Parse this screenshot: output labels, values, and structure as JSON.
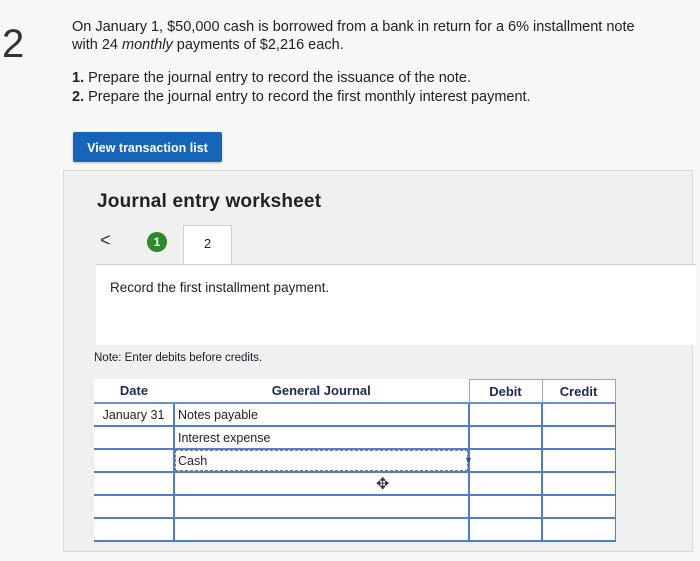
{
  "question_number": "2",
  "prompt": {
    "line1_before": "On January 1, $50,000 cash is borrowed from a bank in return for a 6% installment note",
    "line2_before": "with 24 ",
    "line2_italic": "monthly",
    "line2_after": " payments of $2,216 each."
  },
  "tasks": [
    {
      "num": "1.",
      "text": " Prepare the journal entry to record the issuance of the note."
    },
    {
      "num": "2.",
      "text": " Prepare the journal entry to record the first monthly interest payment."
    }
  ],
  "view_button_label": "View transaction list",
  "worksheet": {
    "title": "Journal entry worksheet",
    "back_symbol": "<",
    "steps": [
      "1",
      "2"
    ],
    "instruction": "Record the first installment payment.",
    "note": "Note: Enter debits before credits."
  },
  "journal": {
    "headers": {
      "date": "Date",
      "journal": "General Journal",
      "debit": "Debit",
      "credit": "Credit"
    },
    "rows": [
      {
        "date": "January 31",
        "account": "Notes payable",
        "debit": "",
        "credit": ""
      },
      {
        "date": "",
        "account": "Interest expense",
        "debit": "",
        "credit": ""
      },
      {
        "date": "",
        "account": "Cash",
        "debit": "",
        "credit": ""
      },
      {
        "date": "",
        "account": "",
        "debit": "",
        "credit": ""
      },
      {
        "date": "",
        "account": "",
        "debit": "",
        "credit": ""
      },
      {
        "date": "",
        "account": "",
        "debit": "",
        "credit": ""
      }
    ]
  }
}
